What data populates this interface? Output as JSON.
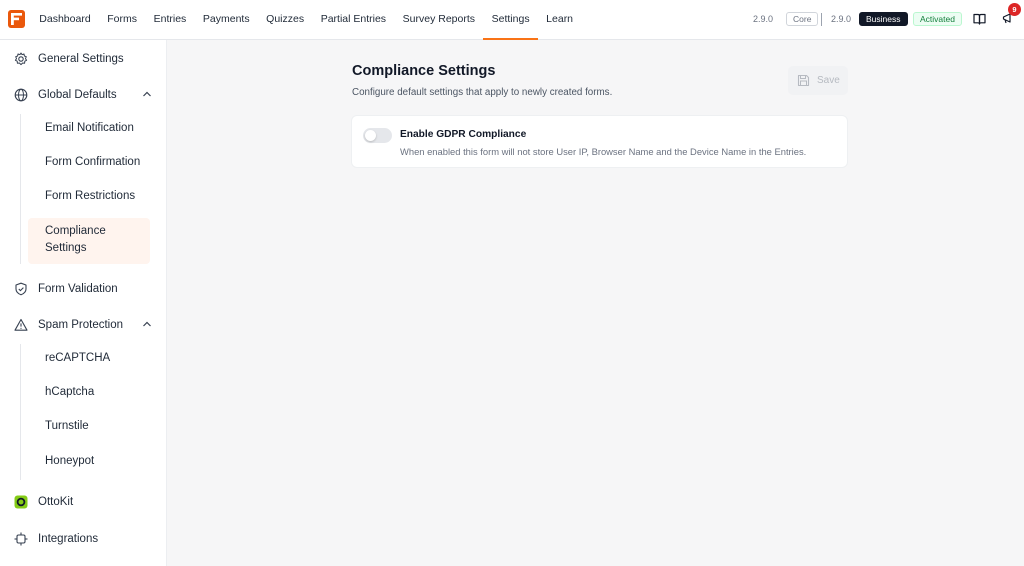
{
  "topbar": {
    "nav": [
      "Dashboard",
      "Forms",
      "Entries",
      "Payments",
      "Quizzes",
      "Partial Entries",
      "Survey Reports",
      "Settings",
      "Learn"
    ],
    "active_nav": "Settings",
    "core_version": "2.9.0",
    "core_label": "Core",
    "business_version": "2.9.0",
    "business_label": "Business",
    "status": "Activated",
    "notification_count": "9"
  },
  "sidebar": {
    "general_settings": "General Settings",
    "global_defaults": "Global Defaults",
    "global_defaults_items": [
      "Email Notification",
      "Form Confirmation",
      "Form Restrictions",
      "Compliance Settings"
    ],
    "active_item": "Compliance Settings",
    "form_validation": "Form Validation",
    "spam_protection": "Spam Protection",
    "spam_protection_items": [
      "reCAPTCHA",
      "hCaptcha",
      "Turnstile",
      "Honeypot"
    ],
    "ottokit": "OttoKit",
    "integrations": "Integrations"
  },
  "main": {
    "title": "Compliance Settings",
    "description": "Configure default settings that apply to newly created forms.",
    "save_label": "Save",
    "gdpr": {
      "title": "Enable GDPR Compliance",
      "description": "When enabled this form will not store User IP, Browser Name and the Device Name in the Entries.",
      "enabled": false
    }
  },
  "colors": {
    "accent": "#f97316",
    "active_bg": "#fff4ee",
    "badge": "#dc2626",
    "ottokit_green": "#84cc16"
  }
}
